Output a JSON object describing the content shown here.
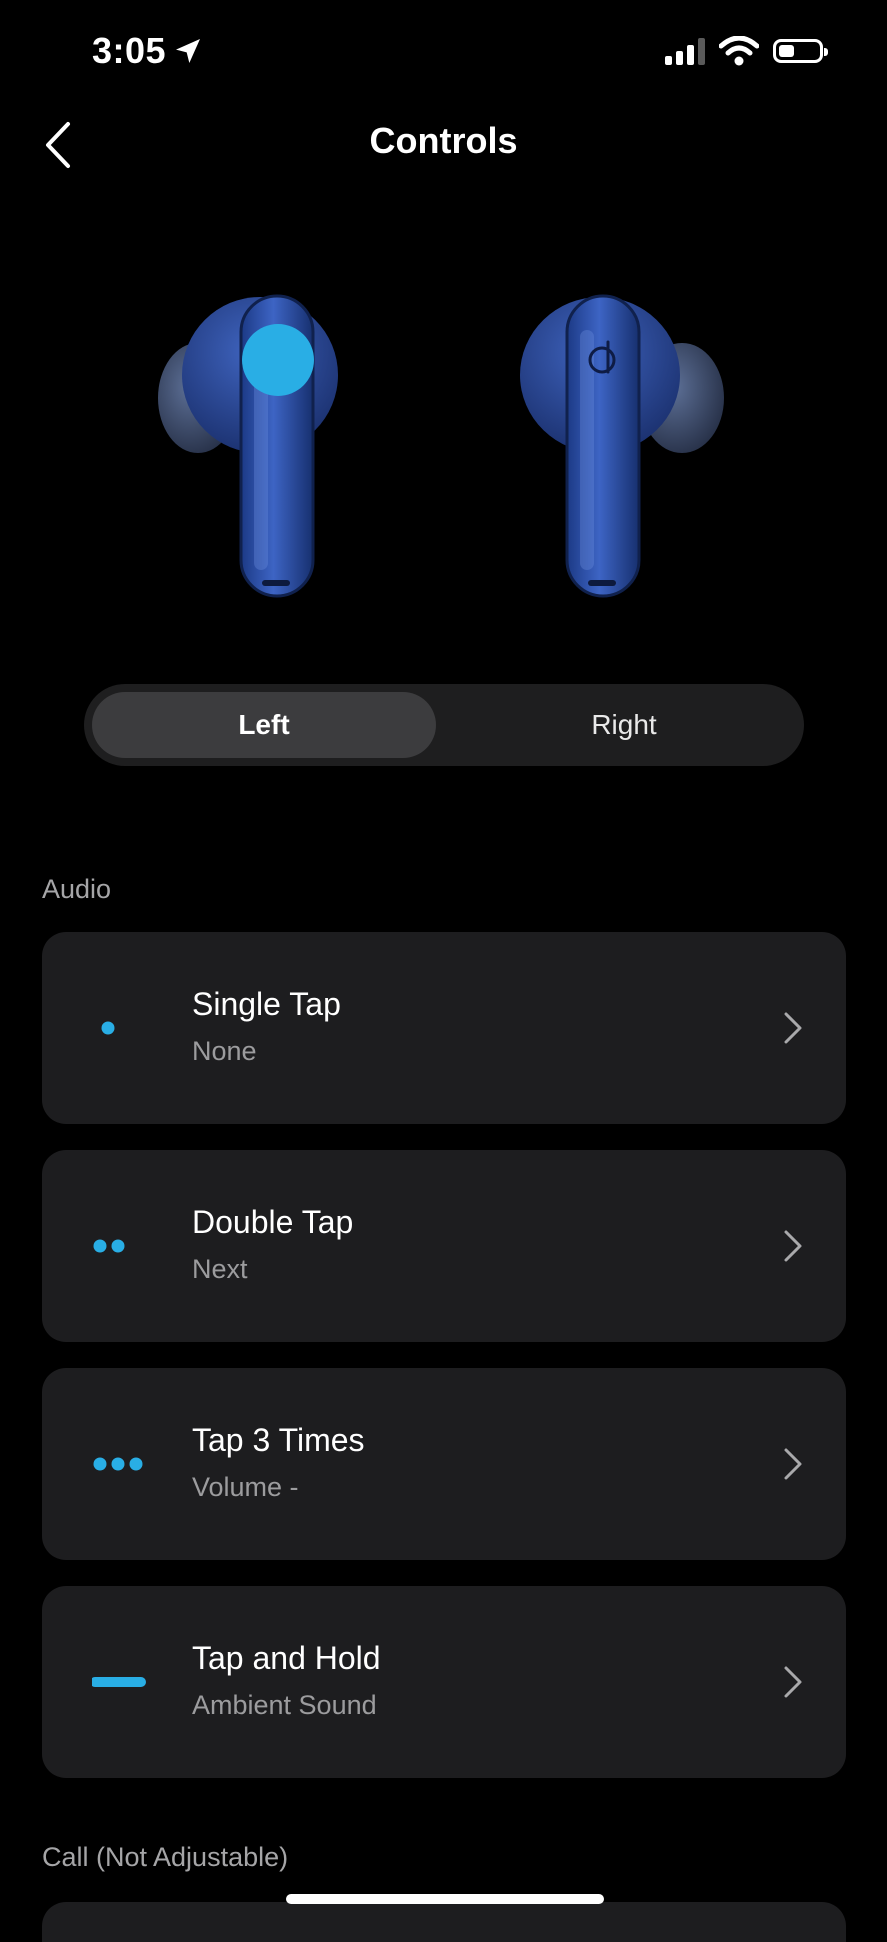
{
  "status_bar": {
    "time": "3:05",
    "signal_bars_filled": 3,
    "signal_bars_total": 4,
    "battery_level": 0.4,
    "icons": [
      "location-arrow-icon",
      "cellular-signal-icon",
      "wifi-icon",
      "battery-icon"
    ]
  },
  "nav": {
    "title": "Controls",
    "back_icon": "chevron-left-icon"
  },
  "side_selector": {
    "options": [
      "Left",
      "Right"
    ],
    "selected": "Left"
  },
  "sections": {
    "audio_label": "Audio",
    "call_label": "Call (Not Adjustable)"
  },
  "controls": [
    {
      "title": "Single Tap",
      "value": "None",
      "icon": "single-dot-icon"
    },
    {
      "title": "Double Tap",
      "value": "Next",
      "icon": "double-dot-icon"
    },
    {
      "title": "Tap 3 Times",
      "value": "Volume -",
      "icon": "triple-dot-icon"
    },
    {
      "title": "Tap and Hold",
      "value": "Ambient Sound",
      "icon": "hold-bar-icon"
    }
  ],
  "colors": {
    "background": "#000000",
    "card": "#1d1d1f",
    "accent": "#29aee5",
    "earbud_blue": "#2a4fa8",
    "segment_selected": "#3c3c3e",
    "secondary_text": "#9c9c9e"
  }
}
